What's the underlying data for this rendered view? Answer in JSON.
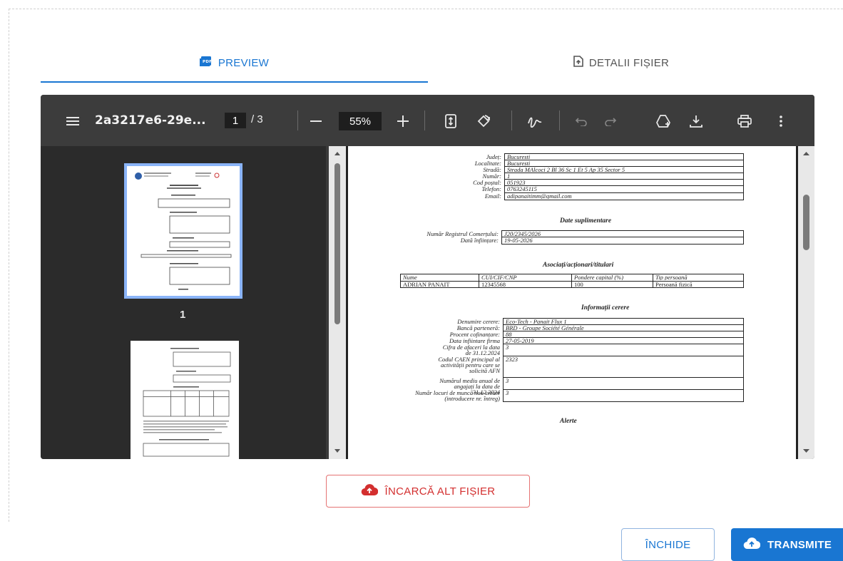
{
  "tabs": {
    "preview_label": "PREVIEW",
    "details_label": "DETALII FIȘIER"
  },
  "viewer": {
    "file_name": "2a3217e6-29e...",
    "current_page": "1",
    "page_separator": "/",
    "total_pages": "3",
    "zoom": "55%",
    "thumbnail_page_label": "1"
  },
  "document": {
    "contact": [
      {
        "label": "Județ:",
        "value": "Bucuresti"
      },
      {
        "label": "Localitate:",
        "value": "Bucuresti"
      },
      {
        "label": "Stradă:",
        "value": "Strada MAlcoci 2 Bl 36 Sc 1 Et 5 Ap 35 Sector 5"
      },
      {
        "label": "Număr:",
        "value": "1"
      },
      {
        "label": "Cod poștal:",
        "value": "051923"
      },
      {
        "label": "Telefon:",
        "value": "0763245115"
      },
      {
        "label": "Email:",
        "value": "adipanaitimm@gmail.com"
      }
    ],
    "extra_title": "Date suplimentare",
    "extra": [
      {
        "label": "Număr Registrul Comerțului:",
        "value": "J20/2345/2026"
      },
      {
        "label": "Dată înființare:",
        "value": "19-05-2026"
      }
    ],
    "shareholders_title": "Asociați/acționari/titulari",
    "shareholders_headers": [
      "Nume",
      "CUI/CIF/CNP",
      "Pondere capital (%)",
      "Tip persoană"
    ],
    "shareholders_row": [
      "ADRIAN PANAIT",
      "12345568",
      "100",
      "Persoană fizică"
    ],
    "request_title": "Informații cerere",
    "request": [
      {
        "label": "Denumire cerere:",
        "value": "Eco-Tech - Panait Flux 1"
      },
      {
        "label": "Bancă parteneră:",
        "value": "BRD - Groupe Société Générale"
      },
      {
        "label": "Procent cofinanțare:",
        "value": "88"
      },
      {
        "label": "Data infiintare firma",
        "value": "27-05-2019"
      },
      {
        "label": "Cifra de afaceri la data de 31.12.2024",
        "value": "3"
      },
      {
        "label": "Codul CAEN principal al activității pentru care se solicită AFN",
        "value": "2323"
      },
      {
        "label": "Numărul mediu anual de angajați la data de 31.12.2024",
        "value": "3"
      },
      {
        "label": "Număr locuri de muncă nou create (introducere nr. întreg)",
        "value": "3"
      }
    ],
    "alerts_title": "Alerte"
  },
  "actions": {
    "upload_label": "ÎNCARCĂ ALT FIȘIER",
    "close_label": "ÎNCHIDE",
    "send_label": "TRANSMITE"
  },
  "colors": {
    "accent": "#1976d2",
    "danger": "#d32f2f",
    "viewer_bg": "#3c3c3c"
  }
}
